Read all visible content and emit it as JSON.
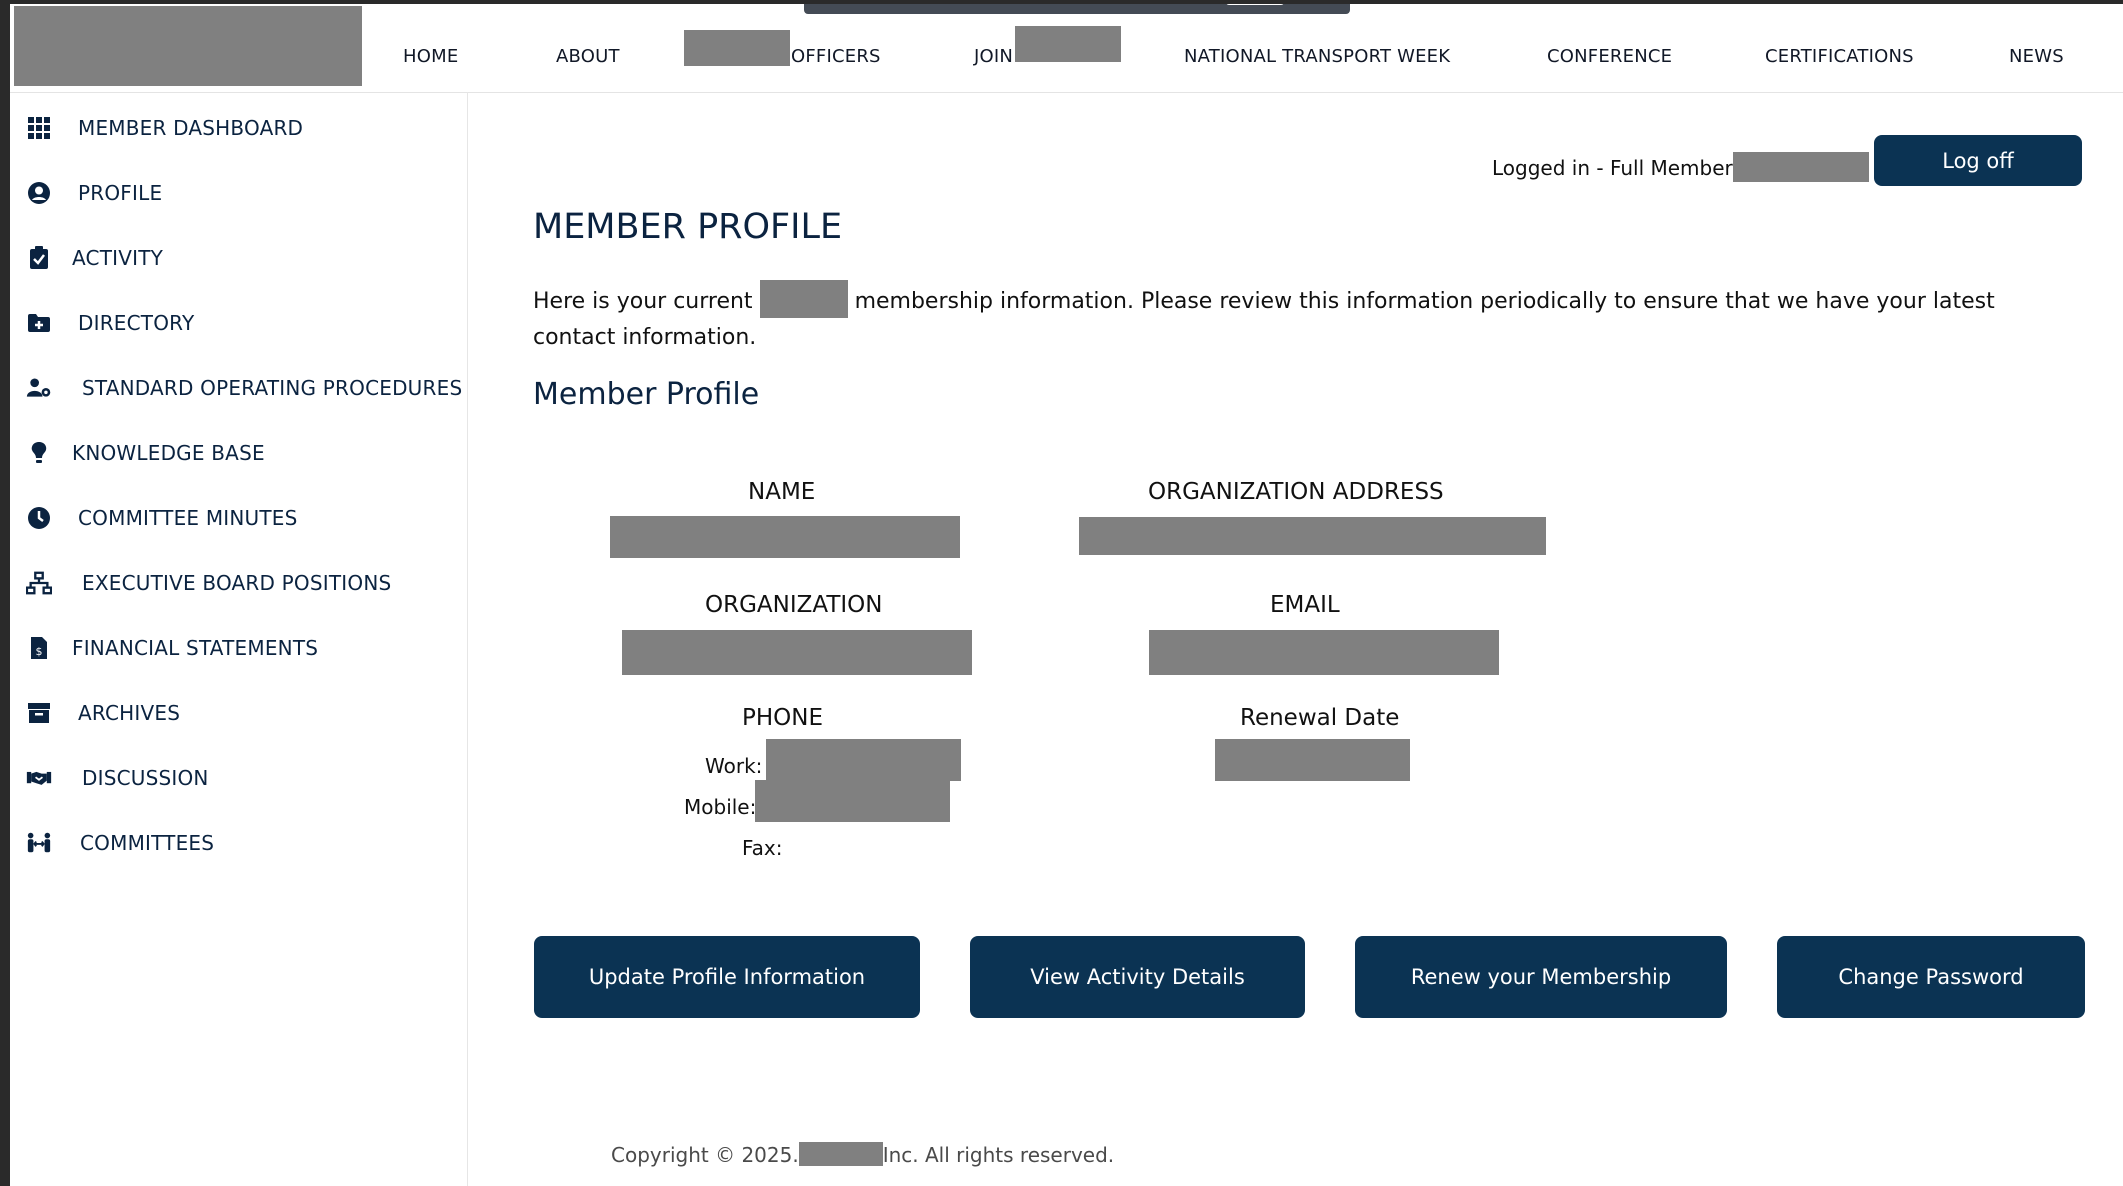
{
  "nav": {
    "items": [
      "HOME",
      "ABOUT",
      "OFFICERS",
      "JOIN",
      "NATIONAL TRANSPORT WEEK",
      "CONFERENCE",
      "CERTIFICATIONS",
      "NEWS"
    ]
  },
  "sidebar": {
    "items": [
      {
        "label": "MEMBER DASHBOARD",
        "icon": "grid-icon"
      },
      {
        "label": "PROFILE",
        "icon": "user-circle-icon"
      },
      {
        "label": "ACTIVITY",
        "icon": "clipboard-check-icon"
      },
      {
        "label": "DIRECTORY",
        "icon": "folder-plus-icon"
      },
      {
        "label": "STANDARD OPERATING PROCEDURES",
        "icon": "user-gear-icon"
      },
      {
        "label": "KNOWLEDGE BASE",
        "icon": "lightbulb-icon"
      },
      {
        "label": "COMMITTEE MINUTES",
        "icon": "clock-icon"
      },
      {
        "label": "EXECUTIVE BOARD POSITIONS",
        "icon": "sitemap-icon"
      },
      {
        "label": "FINANCIAL STATEMENTS",
        "icon": "invoice-dollar-icon"
      },
      {
        "label": "ARCHIVES",
        "icon": "archive-box-icon"
      },
      {
        "label": "DISCUSSION",
        "icon": "handshake-icon"
      },
      {
        "label": "COMMITTEES",
        "icon": "people-arrows-icon"
      }
    ]
  },
  "session": {
    "logged_in_text": "Logged in - Full Member :",
    "logoff_label": "Log off"
  },
  "main": {
    "title": "MEMBER PROFILE",
    "intro_before": "Here is your current",
    "intro_after": "membership information. Please review this information periodically to ensure that we have your latest contact information.",
    "section_title": "Member Profile",
    "labels": {
      "name": "NAME",
      "org_address": "ORGANIZATION ADDRESS",
      "organization": "ORGANIZATION",
      "email": "EMAIL",
      "phone": "PHONE",
      "renewal": "Renewal Date",
      "work": "Work:",
      "mobile": "Mobile:",
      "fax": "Fax:"
    }
  },
  "actions": {
    "update_profile": "Update Profile Information",
    "view_activity": "View Activity Details",
    "renew": "Renew your Membership",
    "change_password": "Change Password"
  },
  "footer": {
    "before": "Copyright © 2025.",
    "after": "Inc. All rights reserved."
  },
  "colors": {
    "primary": "#0b3353",
    "heading": "#0b2340",
    "redaction": "#808080"
  }
}
